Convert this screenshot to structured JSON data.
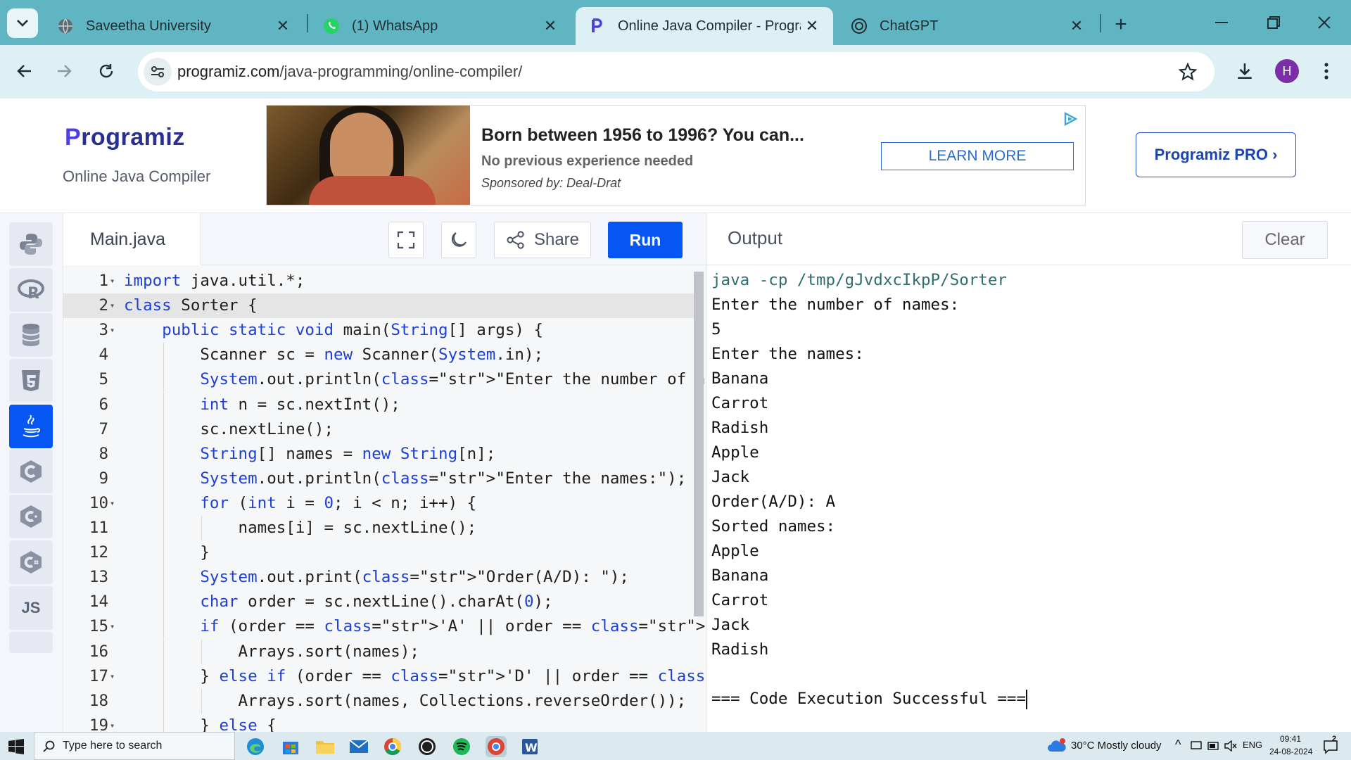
{
  "browser": {
    "tabs": [
      {
        "title": "Saveetha University",
        "icon": "globe-icon"
      },
      {
        "title": "(1) WhatsApp",
        "icon": "whatsapp-icon"
      },
      {
        "title": "Online Java Compiler - Program",
        "icon": "programiz-icon"
      },
      {
        "title": "ChatGPT",
        "icon": "chatgpt-icon"
      }
    ],
    "active_tab": 2,
    "url_domain": "programiz.com",
    "url_path": "/java-programming/online-compiler/",
    "profile_initial": "H"
  },
  "site": {
    "logo": "rogramiz",
    "logo_mark": "P",
    "subtitle": "Online Java Compiler",
    "pro_button": "Programiz PRO ›"
  },
  "ad": {
    "title": "Born between 1956 to 1996? You can...",
    "subtitle": "No previous experience needed",
    "sponsor": "Sponsored by: Deal-Drat",
    "cta": "LEARN MORE"
  },
  "languages": [
    {
      "name": "python-icon"
    },
    {
      "name": "r-icon"
    },
    {
      "name": "sql-icon"
    },
    {
      "name": "html5-icon"
    },
    {
      "name": "java-icon",
      "active": true
    },
    {
      "name": "c-icon"
    },
    {
      "name": "cpp-icon"
    },
    {
      "name": "csharp-icon"
    },
    {
      "name": "js-icon",
      "label": "JS"
    }
  ],
  "editor": {
    "file_name": "Main.java",
    "share_label": "Share",
    "run_label": "Run",
    "active_line": 2,
    "lines": [
      "import java.util.*;",
      "class Sorter {",
      "    public static void main(String[] args) {",
      "        Scanner sc = new Scanner(System.in);",
      "        System.out.println(\"Enter the number of names: \");",
      "        int n = sc.nextInt();",
      "        sc.nextLine();",
      "        String[] names = new String[n];",
      "        System.out.println(\"Enter the names:\");",
      "        for (int i = 0; i < n; i++) {",
      "            names[i] = sc.nextLine();",
      "        }",
      "        System.out.print(\"Order(A/D): \");",
      "        char order = sc.nextLine().charAt(0);",
      "        if (order == 'A' || order == 'a') {",
      "            Arrays.sort(names);",
      "        } else if (order == 'D' || order == 'd') {",
      "            Arrays.sort(names, Collections.reverseOrder());",
      "        } else {"
    ],
    "fold_lines": [
      1,
      2,
      3,
      10,
      15,
      17,
      19
    ]
  },
  "output": {
    "title": "Output",
    "clear_label": "Clear",
    "lines": [
      "java -cp /tmp/gJvdxcIkpP/Sorter",
      "Enter the number of names:",
      "5",
      "Enter the names:",
      "Banana",
      "Carrot",
      "Radish",
      "Apple",
      "Jack",
      "Order(A/D): A",
      "Sorted names:",
      "Apple",
      "Banana",
      "Carrot",
      "Jack",
      "Radish",
      "",
      "=== Code Execution Successful ==="
    ]
  },
  "taskbar": {
    "search_placeholder": "Type here to search",
    "weather": "30°C  Mostly cloudy",
    "lang": "ENG",
    "time": "09:41",
    "date": "24-08-2024",
    "notifications": "2"
  }
}
